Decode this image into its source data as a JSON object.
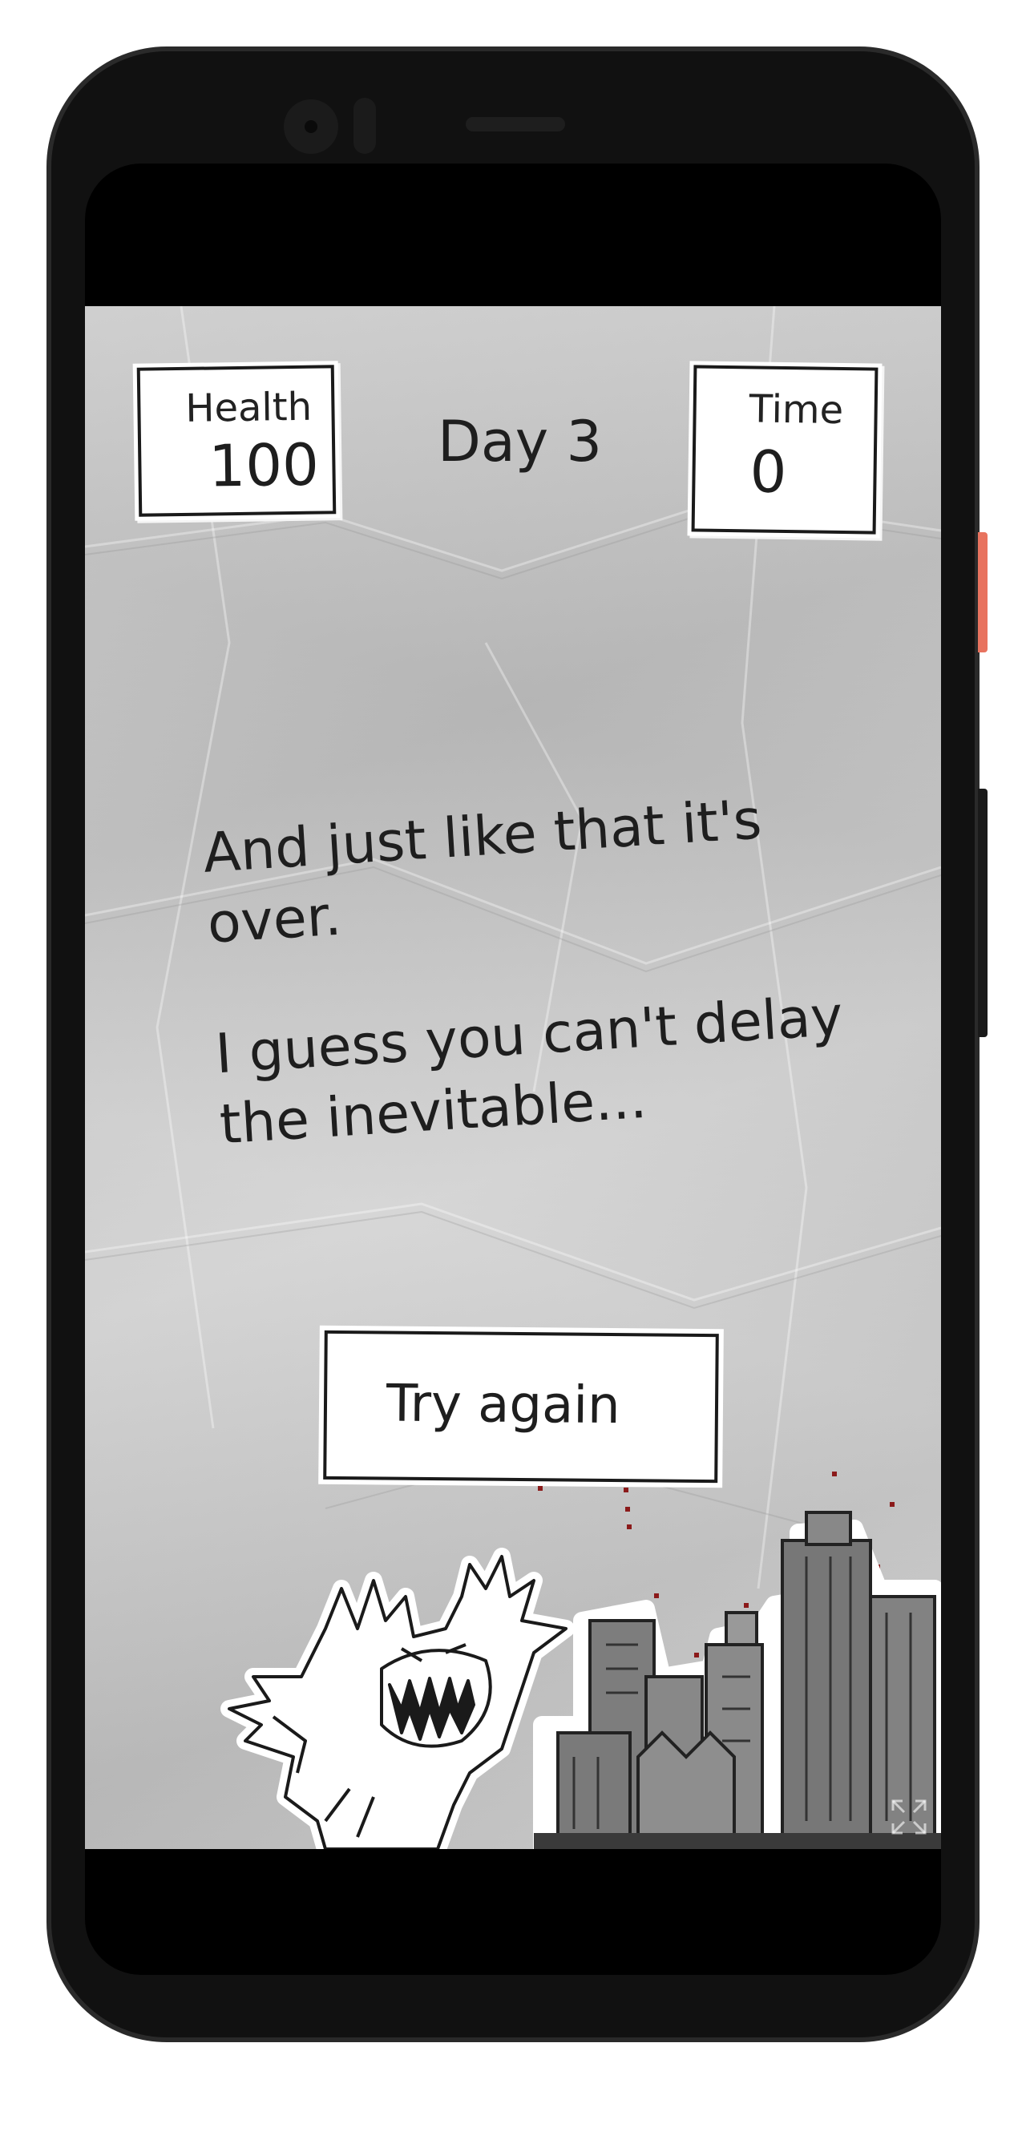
{
  "hud": {
    "health_label": "Health",
    "health_value": "100",
    "day_label": "Day 3",
    "time_label": "Time",
    "time_value": "0"
  },
  "story": {
    "line1": "And just like that it's over.",
    "line2": "I guess you can't delay the inevitable..."
  },
  "button": {
    "label": "Try again"
  },
  "colors": {
    "paper": "#c9c9c9",
    "ink": "#1e1e1e",
    "phone_body": "#111111",
    "side_button_accent": "#e8735f",
    "blood": "#8b1a1a"
  },
  "icons": [
    "monster-illustration",
    "city-skyline-illustration",
    "fullscreen-icon"
  ]
}
